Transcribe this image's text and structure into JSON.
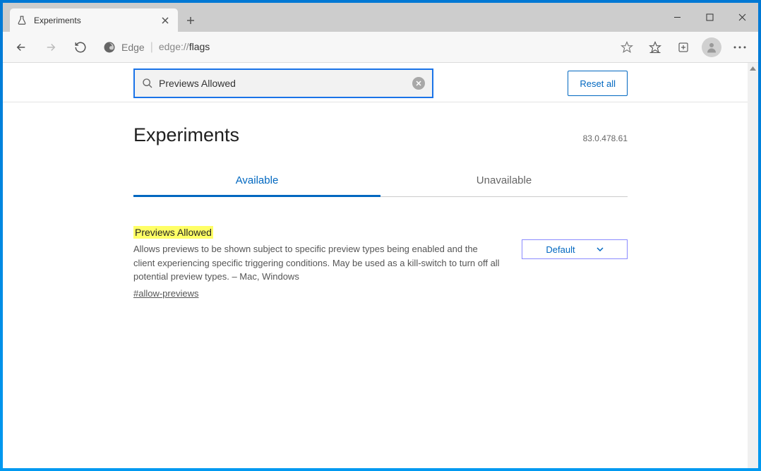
{
  "titlebar": {
    "tab_title": "Experiments"
  },
  "toolbar": {
    "edge_label": "Edge",
    "url_prefix": "edge://",
    "url_path": "flags"
  },
  "search": {
    "value": "Previews Allowed",
    "reset_label": "Reset all"
  },
  "header": {
    "title": "Experiments",
    "version": "83.0.478.61"
  },
  "tabs": {
    "available": "Available",
    "unavailable": "Unavailable"
  },
  "flag": {
    "title": "Previews Allowed",
    "description": "Allows previews to be shown subject to specific preview types being enabled and the client experiencing specific triggering conditions. May be used as a kill-switch to turn off all potential preview types. – Mac, Windows",
    "anchor": "#allow-previews",
    "select_value": "Default"
  }
}
